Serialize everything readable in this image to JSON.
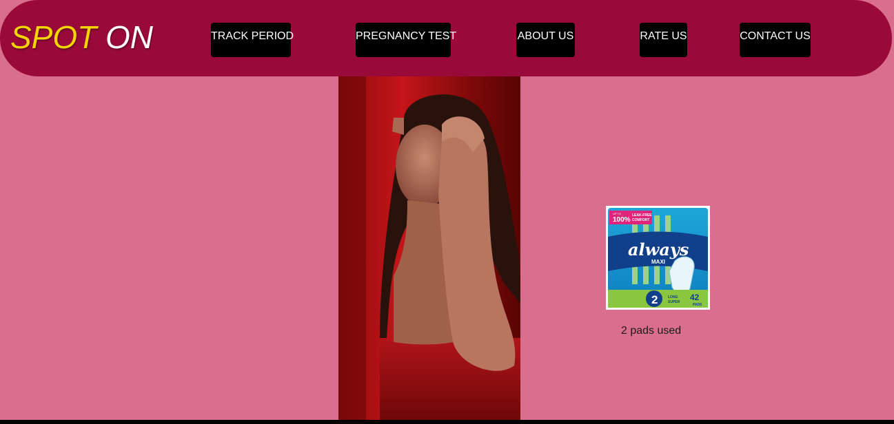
{
  "brand": {
    "part1": "SPOT",
    "part2": "ON",
    "color_part1": "#f2d400",
    "color_part2": "#ffffff"
  },
  "nav": {
    "items": [
      {
        "label": "TRACK PERIOD"
      },
      {
        "label": "PREGNANCY TEST"
      },
      {
        "label": "ABOUT US"
      },
      {
        "label": "RATE US"
      },
      {
        "label": "CONTACT US"
      }
    ]
  },
  "product": {
    "badge_small": "UP TO",
    "badge_main": "100%",
    "badge_line1": "LEAK-FREE",
    "badge_line2": "COMFORT",
    "brand": "always",
    "sub": "MAXI",
    "size_label": "SIZE",
    "size_num": "2",
    "size_desc1": "LONG",
    "size_desc2": "SUPER",
    "count": "42",
    "count_unit": "PADS"
  },
  "pads_used": "2 pads used",
  "colors": {
    "background": "#da6e8e",
    "navbar": "#990a3a",
    "button": "#000000"
  }
}
